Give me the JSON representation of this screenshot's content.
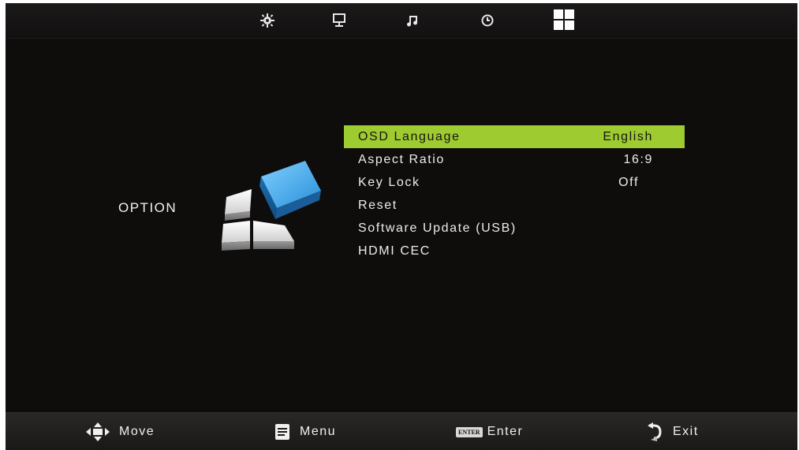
{
  "top_bar": {
    "icons": [
      "picture-settings-icon",
      "monitor-icon",
      "music-note-icon",
      "clock-icon",
      "option-grid-icon"
    ],
    "active": "option-grid-icon"
  },
  "category": {
    "label": "OPTION"
  },
  "menu": {
    "items": [
      {
        "label": "OSD Language",
        "value": "English",
        "selected": true
      },
      {
        "label": "Aspect Ratio",
        "value": "16:9",
        "selected": false
      },
      {
        "label": "Key Lock",
        "value": "Off",
        "selected": false
      },
      {
        "label": "Reset",
        "value": "",
        "selected": false
      },
      {
        "label": "Software Update (USB)",
        "value": "",
        "selected": false
      },
      {
        "label": "HDMI CEC",
        "value": "",
        "selected": false
      }
    ]
  },
  "bottom_bar": {
    "move_label": "Move",
    "menu_label": "Menu",
    "enter_badge": "ENTER",
    "enter_label": "Enter",
    "exit_label": "Exit"
  },
  "colors": {
    "highlight": "#9ecb2f",
    "background": "#0f0d0c",
    "accent_blue": "#3a9fe0"
  }
}
